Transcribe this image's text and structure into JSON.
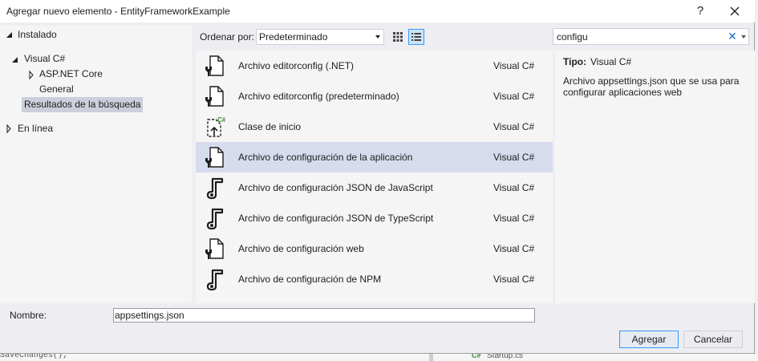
{
  "window": {
    "title": "Agregar nuevo elemento - EntityFrameworkExample",
    "help_label": "?"
  },
  "tree": {
    "installed": "Instalado",
    "visual_csharp": "Visual C#",
    "aspnet_core": "ASP.NET Core",
    "general": "General",
    "search_results": "Resultados de la búsqueda",
    "online": "En línea"
  },
  "toolbar": {
    "sort_label": "Ordenar por:",
    "sort_value": "Predeterminado"
  },
  "search": {
    "value": "configu",
    "clear_glyph": "✕"
  },
  "templates": [
    {
      "name": "Archivo editorconfig (.NET)",
      "type": "Visual C#",
      "icon": "editorconfig-file-icon"
    },
    {
      "name": "Archivo editorconfig (predeterminado)",
      "type": "Visual C#",
      "icon": "editorconfig-file-icon"
    },
    {
      "name": "Clase de inicio",
      "type": "Visual C#",
      "icon": "startup-class-icon"
    },
    {
      "name": "Archivo de configuración de la aplicación",
      "type": "Visual C#",
      "icon": "config-file-icon"
    },
    {
      "name": "Archivo de configuración JSON de JavaScript",
      "type": "Visual C#",
      "icon": "json-config-icon"
    },
    {
      "name": "Archivo de configuración JSON de TypeScript",
      "type": "Visual C#",
      "icon": "json-config-icon"
    },
    {
      "name": "Archivo de configuración web",
      "type": "Visual C#",
      "icon": "config-file-icon"
    },
    {
      "name": "Archivo de configuración de NPM",
      "type": "Visual C#",
      "icon": "json-config-icon"
    }
  ],
  "selected_index": 3,
  "details": {
    "type_label": "Tipo:",
    "type_value": "Visual C#",
    "description": "Archivo appsettings.json que se usa para configurar aplicaciones web"
  },
  "name_field": {
    "label": "Nombre:",
    "value": "appsettings.json"
  },
  "buttons": {
    "add": "Agregar",
    "cancel": "Cancelar"
  },
  "background": {
    "code": "SaveChanges();",
    "file": "Startup.cs",
    "cs_badge": "C#"
  },
  "colors": {
    "selection": "#d7dbee",
    "tree_selection": "#cccedb",
    "accent": "#3399ff",
    "csharp_green": "#388a34"
  }
}
